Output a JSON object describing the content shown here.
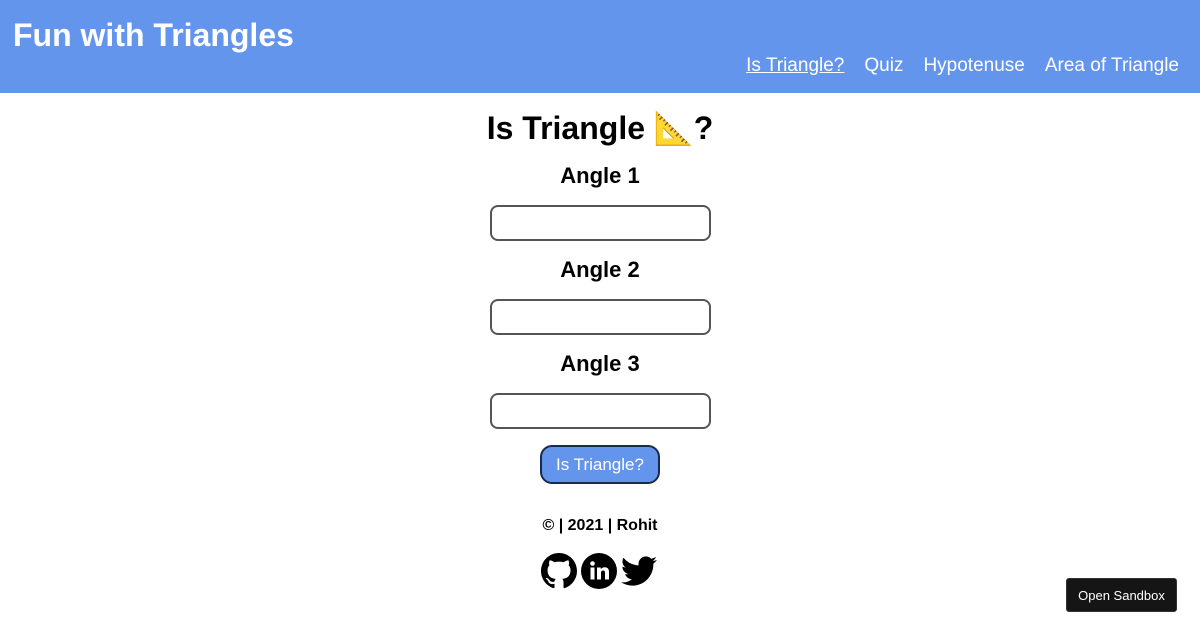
{
  "header": {
    "brand": "Fun with Triangles",
    "nav": [
      {
        "label": "Is Triangle?",
        "active": true
      },
      {
        "label": "Quiz",
        "active": false
      },
      {
        "label": "Hypotenuse",
        "active": false
      },
      {
        "label": "Area of Triangle",
        "active": false
      }
    ]
  },
  "main": {
    "title": "Is Triangle 📐?",
    "fields": [
      {
        "label": "Angle 1",
        "value": ""
      },
      {
        "label": "Angle 2",
        "value": ""
      },
      {
        "label": "Angle 3",
        "value": ""
      }
    ],
    "submit_label": "Is Triangle?"
  },
  "footer": {
    "text": "© | 2021 | Rohit",
    "social_icons": [
      "github-icon",
      "linkedin-icon",
      "twitter-icon"
    ]
  },
  "sandbox": {
    "label": "Open Sandbox"
  },
  "colors": {
    "header_bg": "#6495ed",
    "button_bg": "#6495ed",
    "text": "#000000",
    "header_text": "#ffffff"
  }
}
